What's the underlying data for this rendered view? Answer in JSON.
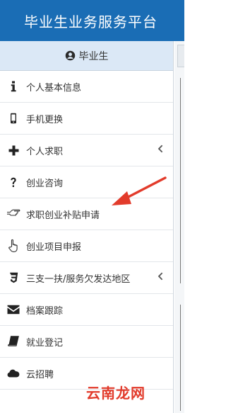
{
  "header": {
    "title": "毕业生业务服务平台"
  },
  "user": {
    "label": "毕业生",
    "icon": "user-circle-icon"
  },
  "menu": [
    {
      "label": "个人基本信息",
      "icon": "info-icon"
    },
    {
      "label": "手机更换",
      "icon": "mobile-icon"
    },
    {
      "label": "个人求职",
      "icon": "plus-icon",
      "expandable": true
    },
    {
      "label": "创业咨询",
      "icon": "question-icon"
    },
    {
      "label": "求职创业补贴申请",
      "icon": "hand-point-icon"
    },
    {
      "label": "创业项目申报",
      "icon": "hand-pointer-icon"
    },
    {
      "label": "三支一扶/服务欠发达地区",
      "icon": "css3-icon",
      "expandable": true
    },
    {
      "label": "档案跟踪",
      "icon": "envelope-icon"
    },
    {
      "label": "就业登记",
      "icon": "book-icon"
    },
    {
      "label": "云招聘",
      "icon": "cloud-icon"
    }
  ],
  "watermark": {
    "text": "云南龙网"
  },
  "colors": {
    "header": "#1a6db5",
    "user_bar": "#dbe8f6",
    "annotation": "#e23b2b"
  }
}
